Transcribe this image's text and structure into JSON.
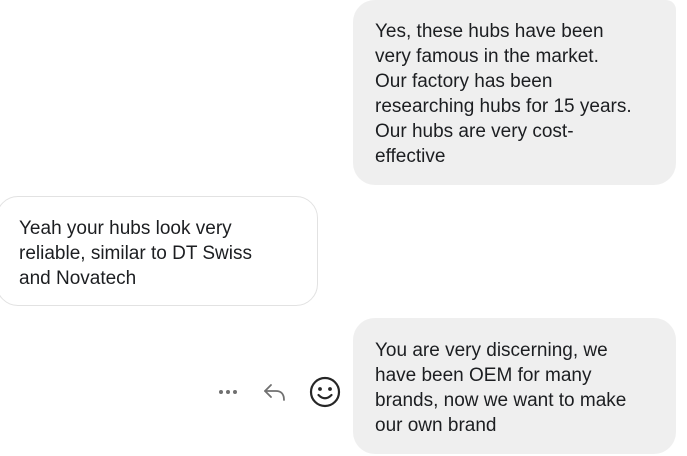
{
  "messages": [
    {
      "direction": "sent",
      "lines": [
        "Yes, these hubs have been",
        "very famous in the market.",
        "Our factory has been",
        "researching hubs for 15 years.",
        "Our hubs are very cost-",
        "effective"
      ]
    },
    {
      "direction": "received",
      "lines": [
        "Yeah your hubs look very",
        "reliable, similar to DT Swiss",
        "and Novatech"
      ]
    },
    {
      "direction": "sent",
      "lines": [
        "You are very discerning, we",
        "have been OEM for many",
        "brands, now we want to make",
        "our own brand"
      ]
    }
  ],
  "message_actions": {
    "icons": [
      "more-icon",
      "reply-icon",
      "smiley-icon"
    ]
  },
  "colors": {
    "sent_bubble": "#efefef",
    "received_border": "#e2e2e2",
    "text": "#1c1e21",
    "icon": "#666666"
  }
}
